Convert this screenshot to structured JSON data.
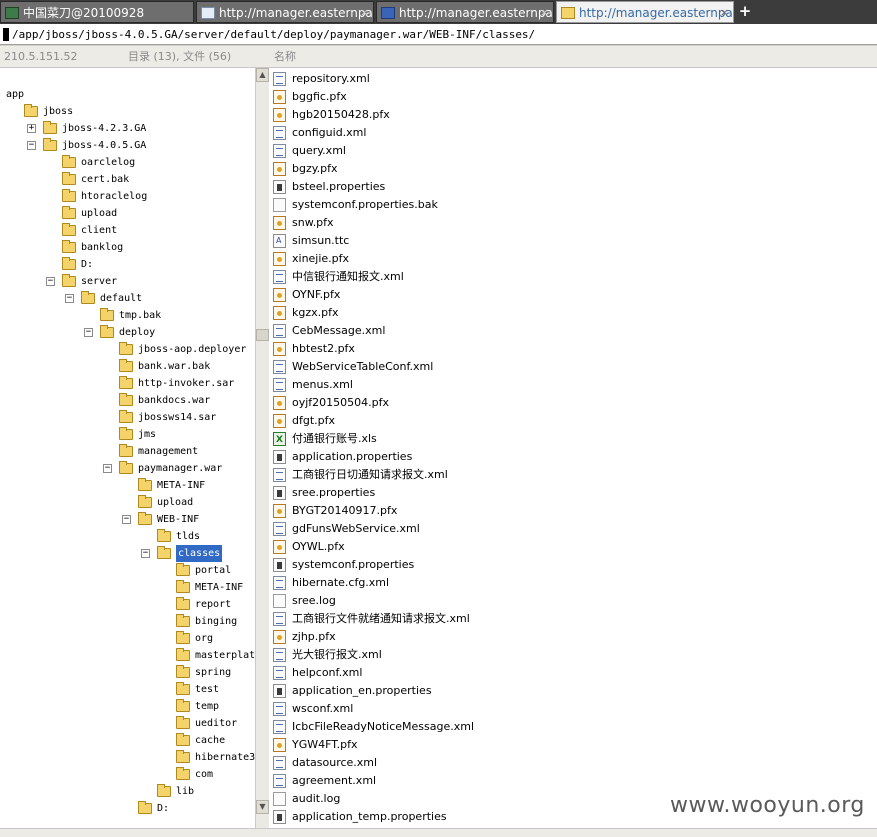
{
  "tabs": [
    {
      "label": "中国菜刀@20100928",
      "icon": "knife-icon",
      "active": false
    },
    {
      "label": "http://manager.easternpay.co...",
      "icon": "page-icon",
      "active": false
    },
    {
      "label": "http://manager.easternpay.co...",
      "icon": "image-icon",
      "active": false
    },
    {
      "label": "http://manager.easternpay.co...",
      "icon": "folder-icon",
      "active": true
    }
  ],
  "new_tab_label": "+",
  "tab_close_glyph": "×",
  "path": "/app/jboss/jboss-4.0.5.GA/server/default/deploy/paymanager.war/WEB-INF/classes/",
  "header": {
    "host": "210.5.151.52",
    "summary": "目录 (13), 文件 (56)",
    "name_col": "名称"
  },
  "tree": [
    {
      "label": "app",
      "depth": 0,
      "toggle": "none",
      "folder": false
    },
    {
      "label": "jboss",
      "depth": 0,
      "toggle": "none",
      "folder": true
    },
    {
      "label": "jboss-4.2.3.GA",
      "depth": 1,
      "toggle": "+",
      "folder": true
    },
    {
      "label": "jboss-4.0.5.GA",
      "depth": 1,
      "toggle": "-",
      "folder": true
    },
    {
      "label": "oarclelog",
      "depth": 2,
      "toggle": "none",
      "folder": true
    },
    {
      "label": "cert.bak",
      "depth": 2,
      "toggle": "none",
      "folder": true
    },
    {
      "label": "htoraclelog",
      "depth": 2,
      "toggle": "none",
      "folder": true
    },
    {
      "label": "upload",
      "depth": 2,
      "toggle": "none",
      "folder": true
    },
    {
      "label": "client",
      "depth": 2,
      "toggle": "none",
      "folder": true
    },
    {
      "label": "banklog",
      "depth": 2,
      "toggle": "none",
      "folder": true
    },
    {
      "label": "D:",
      "depth": 2,
      "toggle": "none",
      "folder": true
    },
    {
      "label": "server",
      "depth": 2,
      "toggle": "-",
      "folder": true
    },
    {
      "label": "default",
      "depth": 3,
      "toggle": "-",
      "folder": true
    },
    {
      "label": "tmp.bak",
      "depth": 4,
      "toggle": "none",
      "folder": true
    },
    {
      "label": "deploy",
      "depth": 4,
      "toggle": "-",
      "folder": true
    },
    {
      "label": "jboss-aop.deployer",
      "depth": 5,
      "toggle": "none",
      "folder": true
    },
    {
      "label": "bank.war.bak",
      "depth": 5,
      "toggle": "none",
      "folder": true
    },
    {
      "label": "http-invoker.sar",
      "depth": 5,
      "toggle": "none",
      "folder": true
    },
    {
      "label": "bankdocs.war",
      "depth": 5,
      "toggle": "none",
      "folder": true
    },
    {
      "label": "jbossws14.sar",
      "depth": 5,
      "toggle": "none",
      "folder": true
    },
    {
      "label": "jms",
      "depth": 5,
      "toggle": "none",
      "folder": true
    },
    {
      "label": "management",
      "depth": 5,
      "toggle": "none",
      "folder": true
    },
    {
      "label": "paymanager.war",
      "depth": 5,
      "toggle": "-",
      "folder": true
    },
    {
      "label": "META-INF",
      "depth": 6,
      "toggle": "none",
      "folder": true
    },
    {
      "label": "upload",
      "depth": 6,
      "toggle": "none",
      "folder": true
    },
    {
      "label": "WEB-INF",
      "depth": 6,
      "toggle": "-",
      "folder": true
    },
    {
      "label": "tlds",
      "depth": 7,
      "toggle": "none",
      "folder": true
    },
    {
      "label": "classes",
      "depth": 7,
      "toggle": "-",
      "folder": true,
      "selected": true
    },
    {
      "label": "portal",
      "depth": 8,
      "toggle": "none",
      "folder": true
    },
    {
      "label": "META-INF",
      "depth": 8,
      "toggle": "none",
      "folder": true
    },
    {
      "label": "report",
      "depth": 8,
      "toggle": "none",
      "folder": true
    },
    {
      "label": "binging",
      "depth": 8,
      "toggle": "none",
      "folder": true
    },
    {
      "label": "org",
      "depth": 8,
      "toggle": "none",
      "folder": true
    },
    {
      "label": "masterplate",
      "depth": 8,
      "toggle": "none",
      "folder": true
    },
    {
      "label": "spring",
      "depth": 8,
      "toggle": "none",
      "folder": true
    },
    {
      "label": "test",
      "depth": 8,
      "toggle": "none",
      "folder": true
    },
    {
      "label": "temp",
      "depth": 8,
      "toggle": "none",
      "folder": true
    },
    {
      "label": "ueditor",
      "depth": 8,
      "toggle": "none",
      "folder": true
    },
    {
      "label": "cache",
      "depth": 8,
      "toggle": "none",
      "folder": true
    },
    {
      "label": "hibernate3",
      "depth": 8,
      "toggle": "none",
      "folder": true
    },
    {
      "label": "com",
      "depth": 8,
      "toggle": "none",
      "folder": true
    },
    {
      "label": "lib",
      "depth": 7,
      "toggle": "none",
      "folder": true
    },
    {
      "label": "D:",
      "depth": 6,
      "toggle": "none",
      "folder": true
    }
  ],
  "files": [
    {
      "name": "repository.xml",
      "type": "xml"
    },
    {
      "name": "bggfic.pfx",
      "type": "pfx"
    },
    {
      "name": "hgb20150428.pfx",
      "type": "pfx"
    },
    {
      "name": "configuid.xml",
      "type": "xml"
    },
    {
      "name": "query.xml",
      "type": "xml"
    },
    {
      "name": "bgzy.pfx",
      "type": "pfx"
    },
    {
      "name": "bsteel.properties",
      "type": "props"
    },
    {
      "name": "systemconf.properties.bak",
      "type": "generic"
    },
    {
      "name": "snw.pfx",
      "type": "pfx"
    },
    {
      "name": "simsun.ttc",
      "type": "font"
    },
    {
      "name": "xinejie.pfx",
      "type": "pfx"
    },
    {
      "name": "中信银行通知报文.xml",
      "type": "xml"
    },
    {
      "name": "OYNF.pfx",
      "type": "pfx"
    },
    {
      "name": "kgzx.pfx",
      "type": "pfx"
    },
    {
      "name": "CebMessage.xml",
      "type": "xml"
    },
    {
      "name": "hbtest2.pfx",
      "type": "pfx"
    },
    {
      "name": "WebServiceTableConf.xml",
      "type": "xml"
    },
    {
      "name": "menus.xml",
      "type": "xml"
    },
    {
      "name": "oyjf20150504.pfx",
      "type": "pfx"
    },
    {
      "name": "dfgt.pfx",
      "type": "pfx"
    },
    {
      "name": "付通银行账号.xls",
      "type": "xls"
    },
    {
      "name": "application.properties",
      "type": "props"
    },
    {
      "name": "工商银行日切通知请求报文.xml",
      "type": "xml"
    },
    {
      "name": "sree.properties",
      "type": "props"
    },
    {
      "name": "BYGT20140917.pfx",
      "type": "pfx"
    },
    {
      "name": "gdFunsWebService.xml",
      "type": "xml"
    },
    {
      "name": "OYWL.pfx",
      "type": "pfx"
    },
    {
      "name": "systemconf.properties",
      "type": "props"
    },
    {
      "name": "hibernate.cfg.xml",
      "type": "xml"
    },
    {
      "name": "sree.log",
      "type": "generic"
    },
    {
      "name": "工商银行文件就绪通知请求报文.xml",
      "type": "xml"
    },
    {
      "name": "zjhp.pfx",
      "type": "pfx"
    },
    {
      "name": "光大银行报文.xml",
      "type": "xml"
    },
    {
      "name": "helpconf.xml",
      "type": "xml"
    },
    {
      "name": "application_en.properties",
      "type": "props"
    },
    {
      "name": "wsconf.xml",
      "type": "xml"
    },
    {
      "name": "IcbcFileReadyNoticeMessage.xml",
      "type": "xml"
    },
    {
      "name": "YGW4FT.pfx",
      "type": "pfx"
    },
    {
      "name": "datasource.xml",
      "type": "xml"
    },
    {
      "name": "agreement.xml",
      "type": "xml"
    },
    {
      "name": "audit.log",
      "type": "generic"
    },
    {
      "name": "application_temp.properties",
      "type": "props"
    }
  ],
  "scrollbars": {
    "left_position": 0.35,
    "right_position": 0.55
  },
  "watermark": "www.wooyun.org"
}
